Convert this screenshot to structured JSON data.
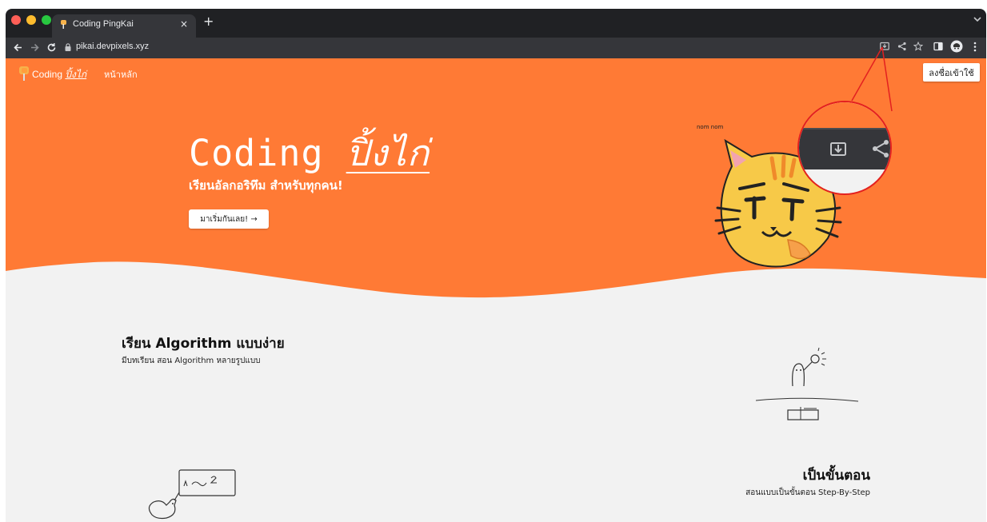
{
  "browser": {
    "tab_title": "Coding PingKai",
    "tab_close": "×",
    "new_tab": "+",
    "url": "pikai.devpixels.xyz",
    "icons": [
      "back-arrow-icon",
      "forward-arrow-icon",
      "reload-icon",
      "lock-icon",
      "install-app-icon",
      "share-icon",
      "bookmark-star-icon",
      "side-panel-icon",
      "profile-icon",
      "menu-kebab-icon",
      "chevron-down-icon"
    ]
  },
  "navbar": {
    "brand_prefix": "Coding",
    "brand_accent": "ปิ้งไก่",
    "home_link": "หน้าหลัก",
    "login_button": "ลงชื่อเข้าใช้"
  },
  "hero": {
    "title_prefix": "Coding",
    "title_accent": "ปิ้งไก่",
    "subtitle": "เรียนอัลกอริทึม สำหรับทุกคน!",
    "cta_label": "มาเริ่มกันเลย!",
    "cta_icon": "arrow-right-icon",
    "mascot_caption": "nom nom"
  },
  "features": [
    {
      "title": "เรียน Algorithm แบบง่าย",
      "description": "มีบทเรียน สอน Algorithm หลายรูปแบบ"
    },
    {
      "title": "เป็นขั้นตอน",
      "description": "สอนแบบเป็นขั้นตอน Step-By-Step"
    }
  ],
  "doodle_labels": {
    "board_text": "1 → 2"
  },
  "colors": {
    "hero_orange": "#ff7a35",
    "page_bg": "#f2f2f2",
    "tabbar": "#202124",
    "toolbar": "#35363a",
    "callout_red": "#e32020",
    "traffic_red": "#ff5f57",
    "traffic_yellow": "#febc2e",
    "traffic_green": "#28c840"
  }
}
